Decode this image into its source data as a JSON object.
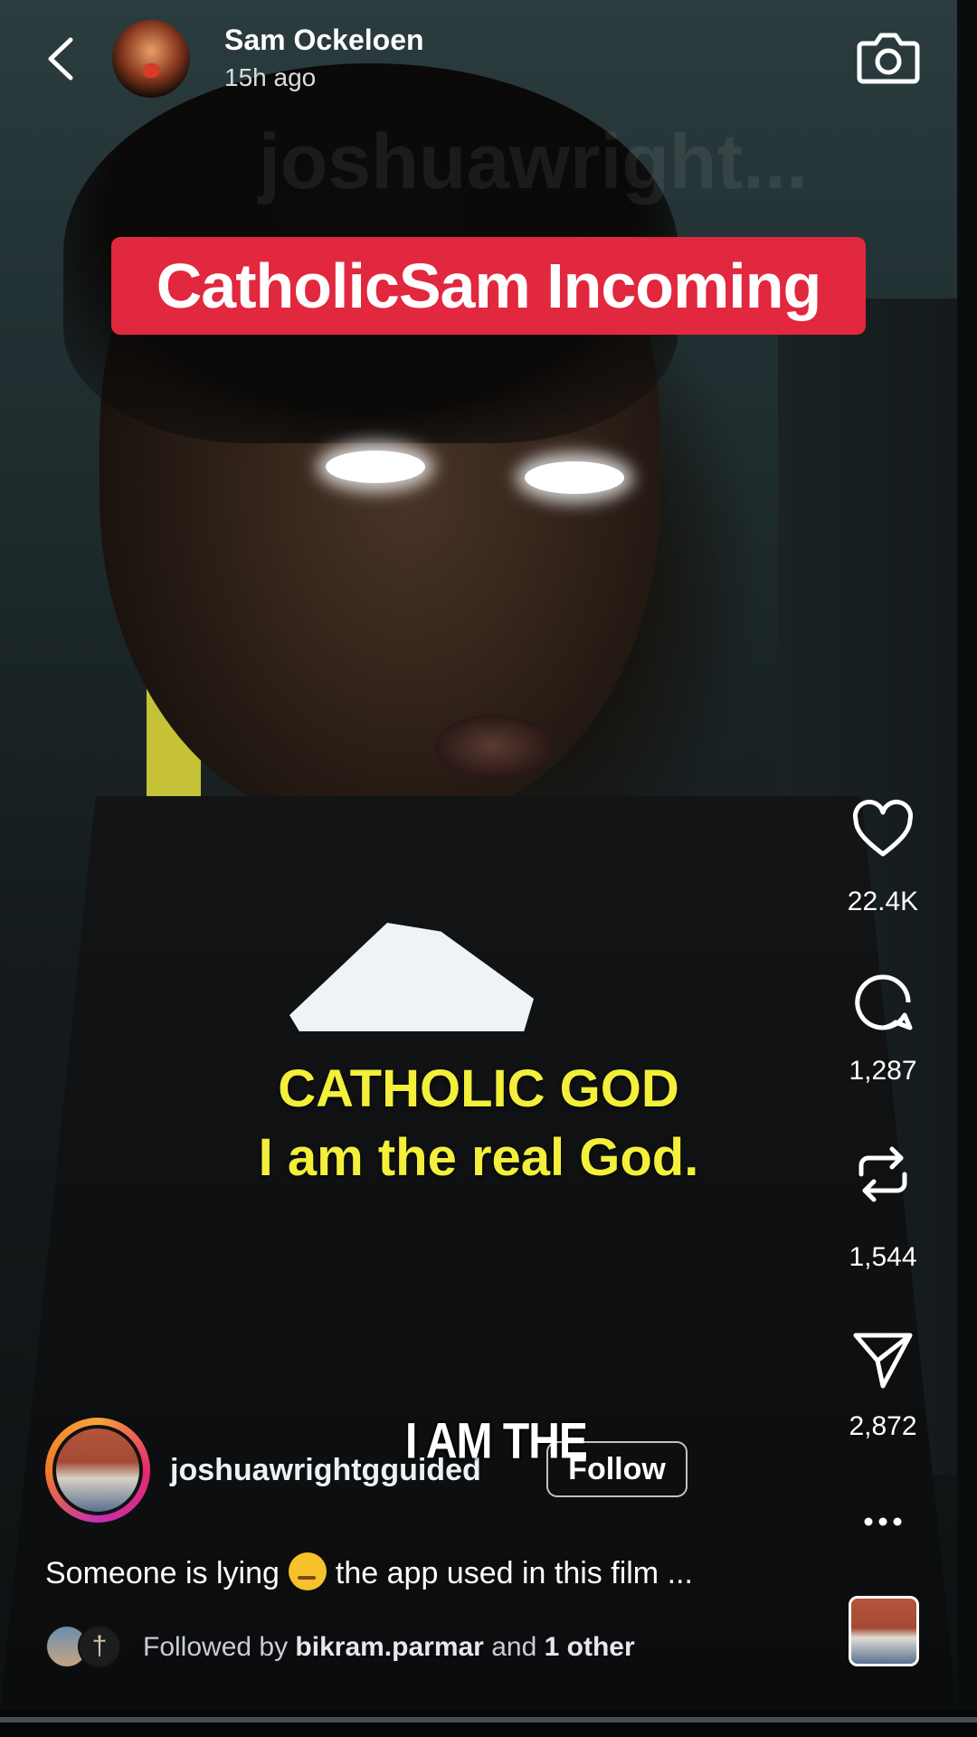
{
  "header": {
    "username": "Sam Ockeloen",
    "time_ago": "15h ago"
  },
  "watermark": "joshuawright...",
  "banner": {
    "text": "CatholicSam Incoming",
    "color": "#e1283e"
  },
  "video_captions": {
    "line1": "CATHOLIC GOD",
    "line2": "I am the real God.",
    "overlay": "I AM THE",
    "color": "#f3ef3a"
  },
  "actions": {
    "likes": "22.4K",
    "comments": "1,287",
    "reposts": "1,544",
    "shares": "2,872",
    "icons": [
      "heart-icon",
      "comment-icon",
      "repost-icon",
      "share-icon",
      "more-icon"
    ]
  },
  "post": {
    "author": "joshuawrightgguided",
    "follow_label": "Follow",
    "caption_before": "Someone is lying",
    "caption_after": "the app used in this film ...",
    "followed_by_prefix": "Followed by",
    "followed_by_user": "bikram.parmar",
    "followed_by_and": "and",
    "followed_by_rest": "1 other"
  }
}
